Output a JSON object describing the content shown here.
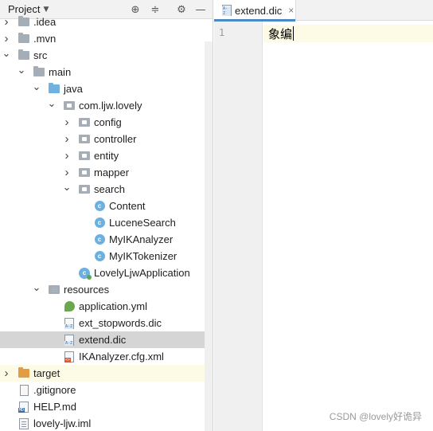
{
  "project_panel": {
    "title": "Project",
    "header_icons": [
      "target-icon",
      "collapse-icon",
      "gear-icon",
      "minimize-icon"
    ]
  },
  "tree": [
    {
      "label": ".idea",
      "indent": 0,
      "chevron": "right",
      "icon": "folder"
    },
    {
      "label": ".mvn",
      "indent": 0,
      "chevron": "right",
      "icon": "folder"
    },
    {
      "label": "src",
      "indent": 0,
      "chevron": "down",
      "icon": "folder"
    },
    {
      "label": "main",
      "indent": 1,
      "chevron": "down",
      "icon": "folder"
    },
    {
      "label": "java",
      "indent": 2,
      "chevron": "down",
      "icon": "folder-blue"
    },
    {
      "label": "com.ljw.lovely",
      "indent": 3,
      "chevron": "down",
      "icon": "package"
    },
    {
      "label": "config",
      "indent": 4,
      "chevron": "right",
      "icon": "package"
    },
    {
      "label": "controller",
      "indent": 4,
      "chevron": "right",
      "icon": "package"
    },
    {
      "label": "entity",
      "indent": 4,
      "chevron": "right",
      "icon": "package"
    },
    {
      "label": "mapper",
      "indent": 4,
      "chevron": "right",
      "icon": "package"
    },
    {
      "label": "search",
      "indent": 4,
      "chevron": "down",
      "icon": "package"
    },
    {
      "label": "Content",
      "indent": 5,
      "chevron": "none",
      "icon": "class"
    },
    {
      "label": "LuceneSearch",
      "indent": 5,
      "chevron": "none",
      "icon": "class"
    },
    {
      "label": "MyIKAnalyzer",
      "indent": 5,
      "chevron": "none",
      "icon": "class"
    },
    {
      "label": "MyIKTokenizer",
      "indent": 5,
      "chevron": "none",
      "icon": "class"
    },
    {
      "label": "LovelyLjwApplication",
      "indent": 4,
      "chevron": "none",
      "icon": "app-class"
    },
    {
      "label": "resources",
      "indent": 2,
      "chevron": "down",
      "icon": "resources-folder"
    },
    {
      "label": "application.yml",
      "indent": 3,
      "chevron": "none",
      "icon": "yml-file"
    },
    {
      "label": "ext_stopwords.dic",
      "indent": 3,
      "chevron": "none",
      "icon": "dic-file"
    },
    {
      "label": "extend.dic",
      "indent": 3,
      "chevron": "none",
      "icon": "dic-file",
      "selected": true
    },
    {
      "label": "IKAnalyzer.cfg.xml",
      "indent": 3,
      "chevron": "none",
      "icon": "xml-file"
    },
    {
      "label": "target",
      "indent": 0,
      "chevron": "right",
      "icon": "folder-orange",
      "highlight": true
    },
    {
      "label": ".gitignore",
      "indent": 0,
      "chevron": "none",
      "icon": "plain-file"
    },
    {
      "label": "HELP.md",
      "indent": 0,
      "chevron": "none",
      "icon": "md-file"
    },
    {
      "label": "lovely-ljw.iml",
      "indent": 0,
      "chevron": "none",
      "icon": "iml-file"
    }
  ],
  "editor": {
    "tab_label": "extend.dic",
    "tab_close": "×",
    "line_number": "1",
    "line_text": "象编"
  },
  "watermark": "CSDN @lovely好诡异",
  "colors": {
    "selection": "#d5d5d5",
    "current_line": "#fdfbe6",
    "tab_underline": "#4a88c7",
    "class_icon": "#6cb0e0",
    "target_folder": "#e39b44"
  }
}
